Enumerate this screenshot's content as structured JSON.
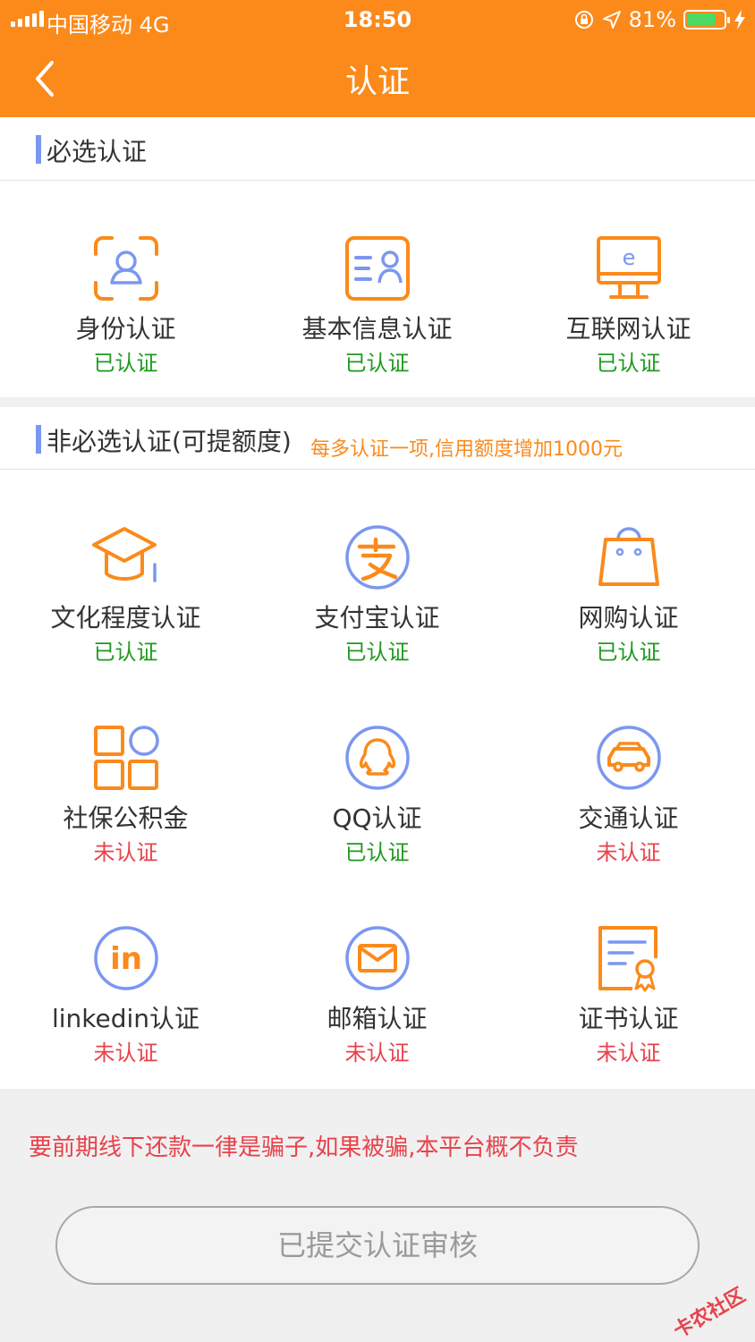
{
  "status_bar": {
    "carrier": "中国移动  4G",
    "time": "18:50",
    "battery": "81%",
    "battery_level": 0.81
  },
  "nav": {
    "title": "认证"
  },
  "required": {
    "title": "必选认证",
    "items": [
      {
        "label": "身份认证",
        "status": "已认证",
        "icon": "id-face-icon"
      },
      {
        "label": "基本信息认证",
        "status": "已认证",
        "icon": "info-card-icon"
      },
      {
        "label": "互联网认证",
        "status": "已认证",
        "icon": "monitor-icon"
      }
    ]
  },
  "optional": {
    "title": "非必选认证(可提额度)",
    "note": "每多认证一项,信用额度增加1000元",
    "items": [
      {
        "label": "文化程度认证",
        "status": "已认证",
        "icon": "graduation-cap-icon"
      },
      {
        "label": "支付宝认证",
        "status": "已认证",
        "icon": "alipay-icon"
      },
      {
        "label": "网购认证",
        "status": "已认证",
        "icon": "shopping-bag-icon"
      },
      {
        "label": "社保公积金",
        "status": "未认证",
        "icon": "grid-icon"
      },
      {
        "label": "QQ认证",
        "status": "已认证",
        "icon": "qq-icon"
      },
      {
        "label": "交通认证",
        "status": "未认证",
        "icon": "car-icon"
      },
      {
        "label": "linkedin认证",
        "status": "未认证",
        "icon": "linkedin-icon"
      },
      {
        "label": "邮箱认证",
        "status": "未认证",
        "icon": "mail-icon"
      },
      {
        "label": "证书认证",
        "status": "未认证",
        "icon": "certificate-icon"
      }
    ]
  },
  "warning": "要前期线下还款一律是骗子,如果被骗,本平台概不负责",
  "submit_label": "已提交认证审核",
  "watermark": "卡农社区",
  "colors": {
    "accent": "#fb8a1b",
    "verified": "#1f9a1f",
    "unverified": "#e8424c",
    "icon_blue": "#7b97f0"
  }
}
